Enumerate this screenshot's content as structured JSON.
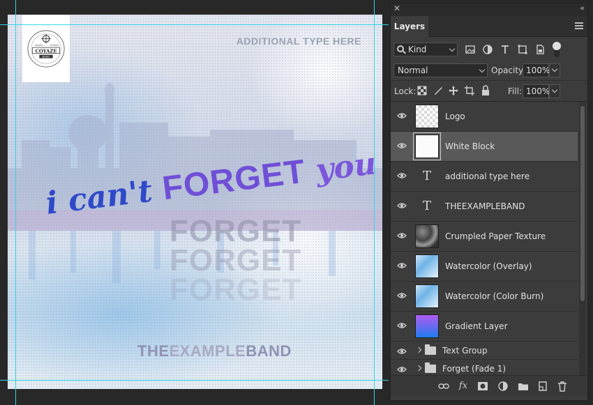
{
  "artwork": {
    "logo": {
      "top_left": "BLACK",
      "top_right": "OCEAN",
      "name": "COYAZE",
      "sub": "MUSIC"
    },
    "additional_type": "ADDITIONAL TYPE HERE",
    "script_title": {
      "part1": "i can't ",
      "part2": "FORGET",
      "part3": " you"
    },
    "fade_word": "FORGET",
    "band": {
      "part1": "THE",
      "part2": "EXAMPLE",
      "part3": "BAND"
    }
  },
  "panel": {
    "close_label": "✕",
    "collapse_label": "‹‹",
    "tab_label": "Layers",
    "filter": {
      "kind_value": "Kind",
      "icons": [
        "image-filter-icon",
        "adjustment-filter-icon",
        "type-filter-icon",
        "shape-filter-icon",
        "smart-object-filter-icon"
      ]
    },
    "blend_mode": "Normal",
    "opacity_label": "Opacity:",
    "opacity_value": "100%",
    "lock_label": "Lock:",
    "fill_label": "Fill:",
    "fill_value": "100%",
    "layers": [
      {
        "name": "Logo",
        "thumb": "checker",
        "visible": true,
        "selected": false
      },
      {
        "name": "White Block",
        "thumb": "sel-white",
        "visible": true,
        "selected": true
      },
      {
        "name": "additional type here",
        "thumb": "text",
        "visible": true,
        "selected": false
      },
      {
        "name": "THEEXAMPLEBAND",
        "thumb": "text",
        "visible": true,
        "selected": false
      },
      {
        "name": "Crumpled Paper Texture",
        "thumb": "crumpled",
        "visible": true,
        "selected": false
      },
      {
        "name": "Watercolor (Overlay)",
        "thumb": "watercolor",
        "visible": true,
        "selected": false
      },
      {
        "name": "Watercolor (Color Burn)",
        "thumb": "watercolor",
        "visible": true,
        "selected": false
      },
      {
        "name": "Gradient Layer",
        "thumb": "gradient",
        "visible": true,
        "selected": false
      },
      {
        "name": "Text Group",
        "thumb": "group",
        "visible": true,
        "selected": false
      },
      {
        "name": "Forget (Fade 1)",
        "thumb": "group",
        "visible": true,
        "selected": false
      }
    ],
    "text_thumb_glyph": "T",
    "bottom_icons": {
      "link": "⊖",
      "fx": "fx",
      "mask": "◘",
      "adjustment": "◐",
      "folder": "▬",
      "new": "⊕",
      "trash": "🗑"
    }
  }
}
